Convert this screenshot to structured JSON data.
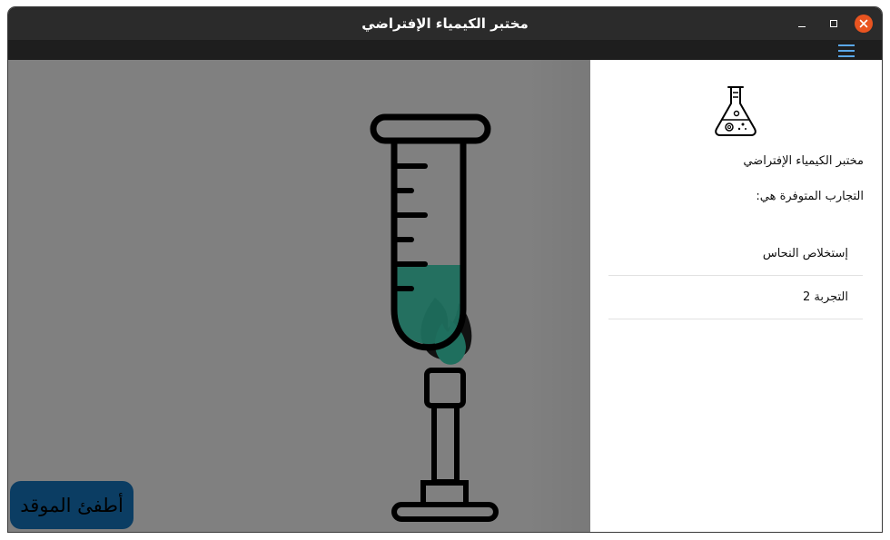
{
  "window": {
    "title": "مختبر الكيمياء الإفتراضي"
  },
  "menubar": {
    "menu_icon": "hamburger-menu-icon"
  },
  "lab": {
    "background_color": "#808080",
    "burner_button_label": "أطفئ الموقد",
    "liquid_color": "#1f6f5e",
    "icons": [
      "test-tube-icon",
      "flame-icon",
      "bunsen-burner-icon"
    ]
  },
  "sidebar": {
    "logo_icon": "flask-icon",
    "app_name": "مختبر الكيمياء الإفتراضي",
    "available_label": "التجارب المتوفرة هي:",
    "experiments": [
      {
        "label": "إستخلاص النحاس"
      },
      {
        "label": "التجربة 2"
      }
    ]
  },
  "colors": {
    "titlebar": "#2b2b2b",
    "close_button": "#e95420",
    "menu_icon": "#5aa7e8",
    "burner_button": "#0b3d63"
  }
}
